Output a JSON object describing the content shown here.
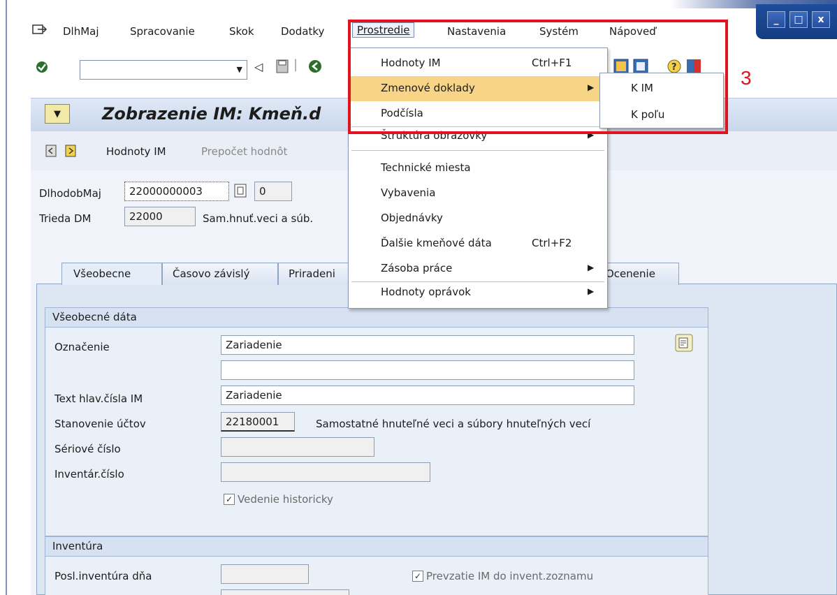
{
  "menubar": {
    "items": [
      "DlhMaj",
      "Spracovanie",
      "Skok",
      "Dodatky",
      "Prostredie",
      "Nastavenia",
      "Systém",
      "Nápoveď"
    ],
    "active": "Prostredie"
  },
  "window_controls": [
    "minimize-icon",
    "maximize-icon",
    "close-icon"
  ],
  "toolbar": {
    "command_field_value": ""
  },
  "title": "Zobrazenie IM: Kmeň.d",
  "app_toolbar": {
    "btn1": "Hodnoty IM",
    "btn2": "Prepočet hodnôt"
  },
  "header": {
    "dlhodobmaj_label": "DlhodobMaj",
    "dlhodobmaj_value": "22000000003",
    "subnumber_value": "0",
    "trieda_label": "Trieda DM",
    "trieda_value": "22000",
    "trieda_desc": "Sam.hnuť.veci a súb."
  },
  "tabs": [
    "Všeobecne",
    "Časovo závislý",
    "Priradeni",
    "Ocenenie"
  ],
  "general_group": {
    "title": "Všeobecné dáta",
    "oznacenie_label": "Označenie",
    "oznacenie_value": "Zariadenie",
    "oznacenie2_value": "",
    "text_label": "Text hlav.čísla IM",
    "text_value": "Zariadenie",
    "stanovenie_label": "Stanovenie účtov",
    "stanovenie_value": "22180001",
    "stanovenie_desc": "Samostatné hnuteľné veci a súbory hnuteľných vecí",
    "seriove_label": "Sériové číslo",
    "seriove_value": "",
    "inventar_label": "Inventár.číslo",
    "inventar_value": "",
    "historicky_label": "Vedenie historicky",
    "historicky_checked": true
  },
  "inventura_group": {
    "title": "Inventúra",
    "posl_label": "Posl.inventúra dňa",
    "posl_value": "",
    "prevzatie_label": "Prevzatie IM do invent.zoznamu",
    "prevzatie_checked": true
  },
  "dropdown": {
    "items": [
      {
        "label": "Hodnoty IM",
        "shortcut": "Ctrl+F1",
        "submenu": false
      },
      {
        "label": "Zmenové doklady",
        "shortcut": "",
        "submenu": true
      },
      {
        "label": "Podčísla",
        "shortcut": "",
        "submenu": false
      },
      {
        "label": "Štruktúra obrazovky",
        "shortcut": "",
        "submenu": true
      },
      {
        "label": "Technické miesta",
        "shortcut": "",
        "submenu": false
      },
      {
        "label": "Vybavenia",
        "shortcut": "",
        "submenu": false
      },
      {
        "label": "Objednávky",
        "shortcut": "",
        "submenu": false
      },
      {
        "label": "Ďalšie kmeňové dáta",
        "shortcut": "Ctrl+F2",
        "submenu": false
      },
      {
        "label": "Zásoba práce",
        "shortcut": "",
        "submenu": true
      },
      {
        "label": "Hodnoty oprávok",
        "shortcut": "",
        "submenu": true
      }
    ]
  },
  "submenu": {
    "items": [
      "K IM",
      "K poľu"
    ]
  },
  "annotation": "3",
  "colors": {
    "highlight": "#f8d487",
    "annotation_red": "#e0141e",
    "window_blue": "#1f4d9c"
  }
}
